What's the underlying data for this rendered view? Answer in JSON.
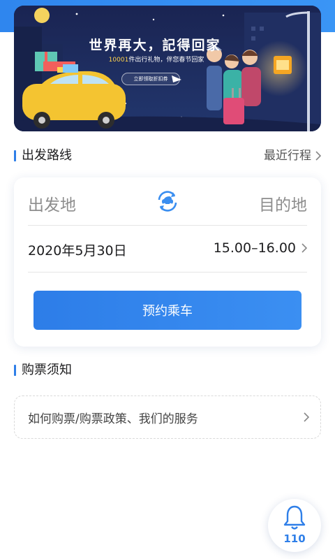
{
  "banner": {
    "title": "世界再大，記得回家",
    "subtitle_highlight": "10001",
    "subtitle_rest": "件出行礼物，伴您春节回家",
    "cta": "立即领取折扣券",
    "colors": {
      "night": "#1b2b5a",
      "car": "#f4c431",
      "lamp": "#f5a623"
    }
  },
  "route_section": {
    "title": "出发路线",
    "recent_trips": "最近行程",
    "origin_placeholder": "出发地",
    "destination_placeholder": "目的地",
    "date": "2020年5月30日",
    "time_range": "15.00–16.00",
    "book_button": "预约乘车",
    "swap_icon": "swap-car-icon"
  },
  "notice_section": {
    "title": "购票须知",
    "item": "如何购票/购票政策、我们的服务"
  },
  "bell": {
    "icon": "bell-icon",
    "label": "110"
  },
  "colors": {
    "accent": "#2f7fe8",
    "top_strip": "#2f86ee"
  }
}
